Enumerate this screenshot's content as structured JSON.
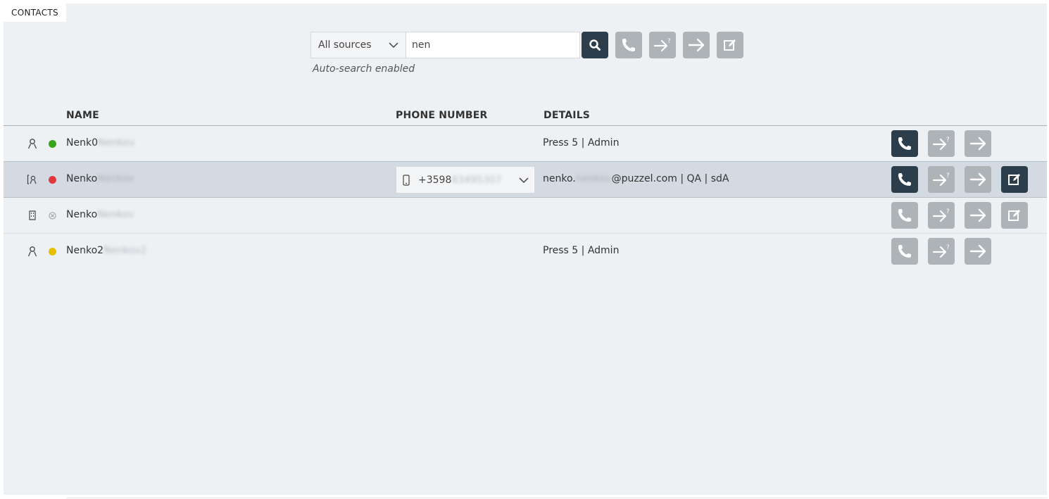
{
  "tab": {
    "label": "CONTACTS"
  },
  "search": {
    "source_value": "All sources",
    "query_value": "nen",
    "auto_note": "Auto-search enabled"
  },
  "columns": {
    "name": "NAME",
    "phone": "PHONE NUMBER",
    "details": "DETAILS"
  },
  "rows": [
    {
      "type": "person-icon",
      "status_color": "#3aa21b",
      "name": "Nenk0",
      "name_blur": "Nenkov",
      "phone": "",
      "details": "Press 5 | Admin",
      "details_prefix": "",
      "details_blur": "",
      "details_suffix": "",
      "actions": [
        "call-dark",
        "consult",
        "transfer"
      ]
    },
    {
      "type": "contact-card-icon",
      "status_color": "#e0383e",
      "name": "Nenko",
      "name_blur": "Nenkov",
      "phone": "+3598",
      "phone_blur": "83495307",
      "details": "",
      "details_prefix": "nenko.",
      "details_blur": "nenkov",
      "details_suffix": "@puzzel.com | QA | sdA",
      "actions": [
        "call-dark",
        "consult",
        "transfer",
        "edit-dark"
      ]
    },
    {
      "type": "building-icon",
      "status_color": "none",
      "name": "Nenko",
      "name_blur": "Nenkov",
      "phone": "",
      "details": "",
      "details_prefix": "",
      "details_blur": "",
      "details_suffix": "",
      "actions": [
        "call",
        "consult",
        "transfer",
        "edit"
      ]
    },
    {
      "type": "person-icon",
      "status_color": "#e6bf00",
      "name": "Nenko2",
      "name_blur": "Nenkov2",
      "phone": "",
      "details": "Press 5 | Admin",
      "details_prefix": "",
      "details_blur": "",
      "details_suffix": "",
      "actions": [
        "call",
        "consult",
        "transfer"
      ]
    }
  ],
  "colors": {
    "dark_button": "#2c3e4c",
    "disabled_button": "#aeb3b8",
    "panel": "#eef1f4",
    "selected_row": "#d3dae1"
  }
}
